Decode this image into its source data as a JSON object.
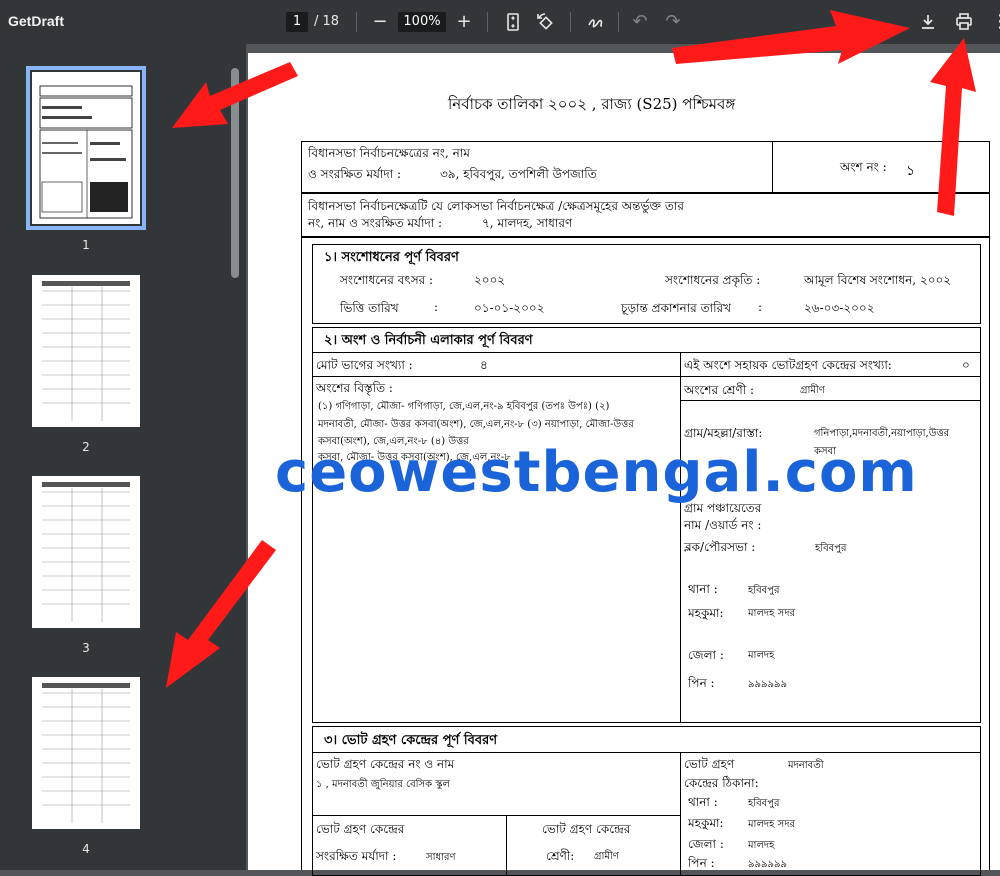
{
  "toolbar": {
    "app_title": "GetDraft",
    "current_page": "1",
    "total_pages": "/ 18",
    "zoom": "100%"
  },
  "sidebar": {
    "thumbnails": [
      {
        "label": "1",
        "selected": true
      },
      {
        "label": "2",
        "selected": false
      },
      {
        "label": "3",
        "selected": false
      },
      {
        "label": "4",
        "selected": false
      }
    ]
  },
  "document": {
    "title": "নির্বাচক তালিকা   ২০০২ , রাজ্য (S25) পশ্চিমবঙ্গ",
    "header": {
      "assembly_label_1": "বিধানসভা নির্বাচনক্ষেত্রের নং, নাম",
      "assembly_label_2": "ও সংরক্ষিত মর্যাদা :",
      "assembly_value": "৩৯, হবিবপুর, তপশিলী উপজাতি",
      "part_label": "অংশ নং :",
      "part_value": "১",
      "parliament_label_1": "বিধানসভা নির্বাচনক্ষেত্রটি যে লোকসভা নির্বাচনক্ষেত্র /ক্ষেত্রসমূহের অন্তর্ভুক্ত তার",
      "parliament_label_2": "নং, নাম  ও সংরক্ষিত মর্যাদা :",
      "parliament_value": "৭, মালদহ, সাধারণ"
    },
    "section1": {
      "heading": "১। সংশোধনের পূর্ণ বিবরণ",
      "year_label": "সংশোধনের বৎসর :",
      "year_value": "২০০২",
      "nature_label": "সংশোধনের প্রকৃতি :",
      "nature_value": "আমূল বিশেষ সংশোধন, ২০০২",
      "base_date_label": "ভিত্তি তারিখ",
      "base_date_colon": ":",
      "base_date_value": "০১-০১-২০০২",
      "final_pub_label": "চূড়ান্ত প্রকাশনার তারিখ",
      "final_pub_colon": ":",
      "final_pub_value": "২৬-০৩-২০০২"
    },
    "section2": {
      "heading": "২। অংশ ও নির্বাচনী এলাকার পূর্ণ বিবরণ",
      "sections_label": "মোট ভাগের সংখ্যা :",
      "sections_value": "৪",
      "aux_label": "এই অংশে সহায়ক ভোটগ্রহণ কেন্দ্রের সংখ্যা:",
      "aux_value": "০",
      "extent_label": "অংশের বিস্তৃতি :",
      "extent_line1": "(১) গণিগাড়া, মৌজা- গণিগাড়া, জে,এল,নং-৯ হবিবপুর (তপঃ উপঃ)  (২)",
      "extent_line2": "মদনাবতী, মৌজা- উত্তর কসবা(অংশ), জে,এল,নং-৮  (৩) নয়াপাড়া, মৌজা-উত্তর",
      "extent_line3": "কসবা(অংশ), জে,এল,নং-৮  (৪) উত্তর",
      "extent_line4": "কসবা, মৌজা- উত্তর কসবা(অংশ), জে,এল,নং-৮",
      "category_label": "অংশের শ্রেণী :",
      "category_value": "গ্রামীণ",
      "village_label": "গ্রাম/মহল্লা/রাস্তা:",
      "village_value": "গনিপাড়া,মদনাবতী,নয়াপাড়া,উত্তর",
      "village_value2": "কসবা",
      "gp_label_1": "গ্রাম পঞ্চায়েতের",
      "gp_label_2": "নাম /ওয়ার্ড নং :",
      "block_label": "ব্লক/পৌরসভা :",
      "block_value": "হবিবপুর",
      "ps_label": "থানা :",
      "ps_value": "হবিবপুর",
      "sub_label": "মহকুমা:",
      "sub_value": "মালদহ সদর",
      "dist_label": "জেলা :",
      "dist_value": "মালদহ",
      "pin_label": "পিন :",
      "pin_value": "৯৯৯৯৯৯"
    },
    "section3": {
      "heading": "৩। ভোট গ্রহণ কেন্দ্রের পূর্ণ বিবরণ",
      "ps_no_label": "ভোট গ্রহণ কেন্দ্রের নং ও নাম",
      "ps_no_value": "১ , মদনাবতী জুনিয়ার বেসিক স্কুল",
      "addr_label_1": "ভোট গ্রহণ",
      "addr_label_2": "কেন্দ্রের ঠিকানা:",
      "addr_value": "মদনাবতী",
      "ps2_label": "থানা :",
      "ps2_value": "হবিবপুর",
      "sub2_label": "মহকুমা:",
      "sub2_value": "মালদহ সদর",
      "dist2_label": "জেলা :",
      "dist2_value": "মালদহ",
      "pin2_label": "পিন :",
      "pin2_value": "৯৯৯৯৯৯",
      "res_label_1": "ভোট গ্রহণ কেন্দ্রের",
      "res_label_2": "সংরক্ষিত মর্যাদা :",
      "res_value": "সাধারণ",
      "cat_label_1": "ভোট গ্রহণ কেন্দ্রের",
      "cat_label_2": "শ্রেণী:",
      "cat_value": "গ্রামীণ"
    },
    "watermark": "ceowestbengal.com"
  },
  "colors": {
    "toolbar": "#323639",
    "viewer_bg": "#525659",
    "selected_thumb": "#8ab4f8",
    "watermark": "#1a63d8",
    "arrow": "#ff1a1a"
  }
}
